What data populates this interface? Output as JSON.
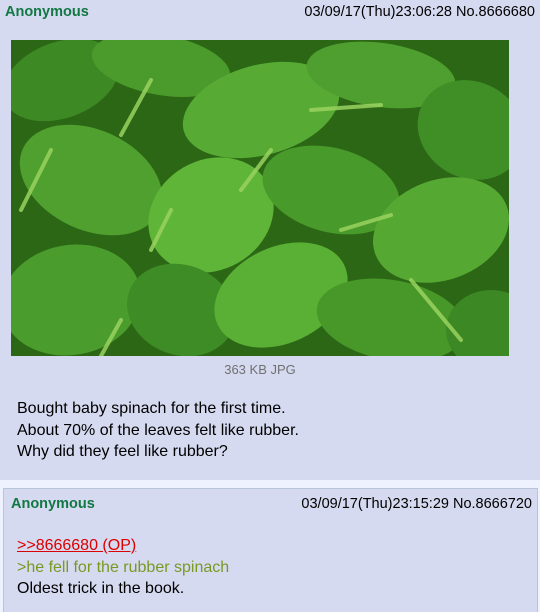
{
  "op": {
    "name": "Anonymous",
    "datetime": "03/09/17(Thu)23:06:28",
    "post_no": "No.8666680",
    "image": {
      "description_icon": "spinach-leaves-photo",
      "colors": [
        "#1f5a12",
        "#3f8a26",
        "#6cbf3a"
      ]
    },
    "file_info": "363 KB JPG",
    "lines": [
      "Bought baby spinach for the first time.",
      "About 70% of the leaves felt like rubber.",
      "Why did they feel like rubber?"
    ]
  },
  "reply": {
    "name": "Anonymous",
    "datetime": "03/09/17(Thu)23:15:29",
    "post_no": "No.8666720",
    "quote_link": ">>8666680 (OP)",
    "greentext": ">he fell for the rubber spinach",
    "text": "Oldest trick in the book."
  },
  "colors": {
    "post_bg": "#d6daf0",
    "page_bg": "#eef2ff",
    "name": "#117743",
    "quote": "#dd0000",
    "greentext": "#789922"
  }
}
